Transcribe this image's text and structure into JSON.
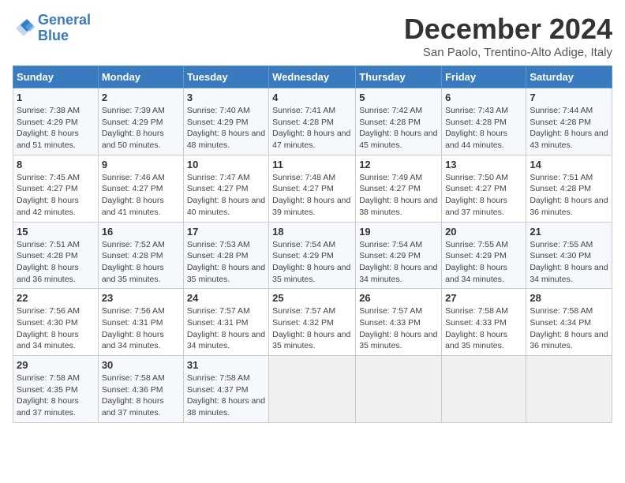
{
  "logo": {
    "line1": "General",
    "line2": "Blue"
  },
  "title": "December 2024",
  "subtitle": "San Paolo, Trentino-Alto Adige, Italy",
  "days_of_week": [
    "Sunday",
    "Monday",
    "Tuesday",
    "Wednesday",
    "Thursday",
    "Friday",
    "Saturday"
  ],
  "weeks": [
    [
      {
        "day": 1,
        "sunrise": "7:38 AM",
        "sunset": "4:29 PM",
        "daylight": "8 hours and 51 minutes."
      },
      {
        "day": 2,
        "sunrise": "7:39 AM",
        "sunset": "4:29 PM",
        "daylight": "8 hours and 50 minutes."
      },
      {
        "day": 3,
        "sunrise": "7:40 AM",
        "sunset": "4:29 PM",
        "daylight": "8 hours and 48 minutes."
      },
      {
        "day": 4,
        "sunrise": "7:41 AM",
        "sunset": "4:28 PM",
        "daylight": "8 hours and 47 minutes."
      },
      {
        "day": 5,
        "sunrise": "7:42 AM",
        "sunset": "4:28 PM",
        "daylight": "8 hours and 45 minutes."
      },
      {
        "day": 6,
        "sunrise": "7:43 AM",
        "sunset": "4:28 PM",
        "daylight": "8 hours and 44 minutes."
      },
      {
        "day": 7,
        "sunrise": "7:44 AM",
        "sunset": "4:28 PM",
        "daylight": "8 hours and 43 minutes."
      }
    ],
    [
      {
        "day": 8,
        "sunrise": "7:45 AM",
        "sunset": "4:27 PM",
        "daylight": "8 hours and 42 minutes."
      },
      {
        "day": 9,
        "sunrise": "7:46 AM",
        "sunset": "4:27 PM",
        "daylight": "8 hours and 41 minutes."
      },
      {
        "day": 10,
        "sunrise": "7:47 AM",
        "sunset": "4:27 PM",
        "daylight": "8 hours and 40 minutes."
      },
      {
        "day": 11,
        "sunrise": "7:48 AM",
        "sunset": "4:27 PM",
        "daylight": "8 hours and 39 minutes."
      },
      {
        "day": 12,
        "sunrise": "7:49 AM",
        "sunset": "4:27 PM",
        "daylight": "8 hours and 38 minutes."
      },
      {
        "day": 13,
        "sunrise": "7:50 AM",
        "sunset": "4:27 PM",
        "daylight": "8 hours and 37 minutes."
      },
      {
        "day": 14,
        "sunrise": "7:51 AM",
        "sunset": "4:28 PM",
        "daylight": "8 hours and 36 minutes."
      }
    ],
    [
      {
        "day": 15,
        "sunrise": "7:51 AM",
        "sunset": "4:28 PM",
        "daylight": "8 hours and 36 minutes."
      },
      {
        "day": 16,
        "sunrise": "7:52 AM",
        "sunset": "4:28 PM",
        "daylight": "8 hours and 35 minutes."
      },
      {
        "day": 17,
        "sunrise": "7:53 AM",
        "sunset": "4:28 PM",
        "daylight": "8 hours and 35 minutes."
      },
      {
        "day": 18,
        "sunrise": "7:54 AM",
        "sunset": "4:29 PM",
        "daylight": "8 hours and 35 minutes."
      },
      {
        "day": 19,
        "sunrise": "7:54 AM",
        "sunset": "4:29 PM",
        "daylight": "8 hours and 34 minutes."
      },
      {
        "day": 20,
        "sunrise": "7:55 AM",
        "sunset": "4:29 PM",
        "daylight": "8 hours and 34 minutes."
      },
      {
        "day": 21,
        "sunrise": "7:55 AM",
        "sunset": "4:30 PM",
        "daylight": "8 hours and 34 minutes."
      }
    ],
    [
      {
        "day": 22,
        "sunrise": "7:56 AM",
        "sunset": "4:30 PM",
        "daylight": "8 hours and 34 minutes."
      },
      {
        "day": 23,
        "sunrise": "7:56 AM",
        "sunset": "4:31 PM",
        "daylight": "8 hours and 34 minutes."
      },
      {
        "day": 24,
        "sunrise": "7:57 AM",
        "sunset": "4:31 PM",
        "daylight": "8 hours and 34 minutes."
      },
      {
        "day": 25,
        "sunrise": "7:57 AM",
        "sunset": "4:32 PM",
        "daylight": "8 hours and 35 minutes."
      },
      {
        "day": 26,
        "sunrise": "7:57 AM",
        "sunset": "4:33 PM",
        "daylight": "8 hours and 35 minutes."
      },
      {
        "day": 27,
        "sunrise": "7:58 AM",
        "sunset": "4:33 PM",
        "daylight": "8 hours and 35 minutes."
      },
      {
        "day": 28,
        "sunrise": "7:58 AM",
        "sunset": "4:34 PM",
        "daylight": "8 hours and 36 minutes."
      }
    ],
    [
      {
        "day": 29,
        "sunrise": "7:58 AM",
        "sunset": "4:35 PM",
        "daylight": "8 hours and 37 minutes."
      },
      {
        "day": 30,
        "sunrise": "7:58 AM",
        "sunset": "4:36 PM",
        "daylight": "8 hours and 37 minutes."
      },
      {
        "day": 31,
        "sunrise": "7:58 AM",
        "sunset": "4:37 PM",
        "daylight": "8 hours and 38 minutes."
      },
      null,
      null,
      null,
      null
    ]
  ],
  "labels": {
    "sunrise": "Sunrise:",
    "sunset": "Sunset:",
    "daylight": "Daylight:"
  }
}
